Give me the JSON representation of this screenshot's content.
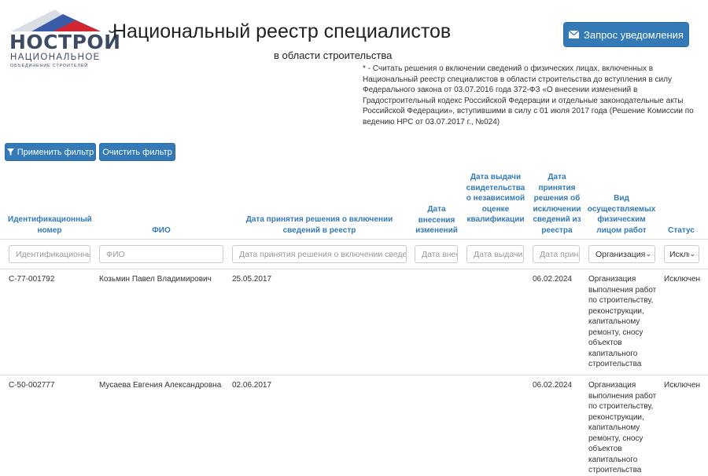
{
  "header": {
    "logo_text": "НОСТРОЙ",
    "logo_sub1": "НАЦИОНАЛЬНОЕ",
    "logo_sub2": "ОБЪЕДИНЕНИЕ СТРОИТЕЛЕЙ",
    "title": "Национальный реестр специалистов",
    "subtitle": "в области строительства",
    "notify_button": "Запрос уведомления",
    "notice": "* - Считать решения о включении сведений о физических лицах, включенных в Национальный реестр специалистов в области строительства до вступления в силу Федерального закона от 03.07.2016 года 372-ФЗ «О внесении изменений в Градостроительный кодекс Российской Федерации и отдельные законодательные акты Российской Федерации», вступившими в силу с 01 июля 2017 года (Решение Комиссии по ведению НРС от 03.07.2017 г., №024)"
  },
  "toolbar": {
    "apply_filter": "Применить фильтр",
    "clear_filter": "Очистить фильтр"
  },
  "table": {
    "columns": [
      "Идентификационный номер",
      "ФИО",
      "Дата принятия решения о включении сведений в реестр",
      "Дата внесения изменений",
      "Дата выдачи свидетельства о независимой оценке квалификации",
      "Дата принятия решения об исключении сведений из реестра",
      "Вид осуществляемых физическим лицом работ",
      "Статус"
    ],
    "filters": {
      "id_placeholder": "Идентификационный номер",
      "fio_placeholder": "ФИО",
      "inclusion_date_placeholder": "Дата принятия решения о включении сведений в реестр",
      "change_date_placeholder": "Дата внесения изменений",
      "cert_date_placeholder": "Дата выдачи свидетельства",
      "exclusion_date_placeholder": "Дата принятия решения",
      "work_type_value": "Организация выполнения работ",
      "status_value": "Исключен"
    },
    "rows": [
      {
        "id": "С-77-001792",
        "fio": "Козьмин Павел Владимирович",
        "inclusion_date": "25.05.2017",
        "change_date": "",
        "cert_date": "",
        "exclusion_date": "06.02.2024",
        "work_type": "Организация выполнения работ по строительству, реконструкции, капитальному ремонту, сносу объектов капитального строительства",
        "status": "Исключен"
      },
      {
        "id": "С-50-002777",
        "fio": "Мусаева Евгения Александровна",
        "inclusion_date": "02.06.2017",
        "change_date": "",
        "cert_date": "",
        "exclusion_date": "06.02.2024",
        "work_type": "Организация выполнения работ по строительству, реконструкции, капитальному ремонту, сносу объектов капитального строительства",
        "status": "Исключен"
      }
    ]
  },
  "colors": {
    "primary": "#337ab7",
    "header_text": "#337ab7",
    "logo": "#3d4a63",
    "flag_red": "#d22630",
    "flag_blue": "#3a5ba7"
  }
}
